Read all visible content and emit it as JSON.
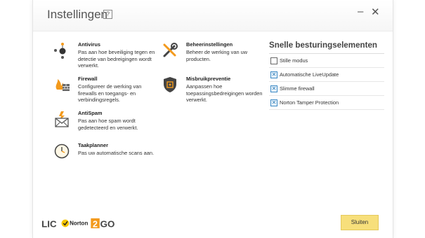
{
  "window": {
    "title": "Instellingen",
    "help_glyph": "?",
    "minimize_glyph": "–",
    "close_glyph": "✕"
  },
  "settings": [
    {
      "icon": "antivirus-icon",
      "name": "Antivirus",
      "desc": "Pas aan hoe beveiliging tegen en detectie van bedreigingen wordt verwerkt."
    },
    {
      "icon": "firewall-icon",
      "name": "Firewall",
      "desc": "Configureer de werking van firewalls en toegangs- en verbindingsregels."
    },
    {
      "icon": "antispam-icon",
      "name": "AntiSpam",
      "desc": "Pas aan hoe spam wordt gedetecteerd en verwerkt."
    },
    {
      "icon": "scheduler-icon",
      "name": "Taakplanner",
      "desc": "Pas uw automatische scans aan."
    },
    {
      "icon": "wrench-tools-icon",
      "name": "Beheerinstellingen",
      "desc": "Beheer de werking van uw producten."
    },
    {
      "icon": "shield-icon",
      "name": "Misbruikpreventie",
      "desc": "Aanpassen hoe toepassingsbedreigingen worden verwerkt."
    }
  ],
  "quick_controls": {
    "title": "Snelle besturingselementen",
    "items": [
      {
        "label": "Stille modus",
        "checked": false
      },
      {
        "label": "Automatische LiveUpdate",
        "checked": true
      },
      {
        "label": "Slimme firewall",
        "checked": true
      },
      {
        "label": "Norton Tamper Protection",
        "checked": true
      }
    ]
  },
  "footer": {
    "close_label": "Sluiten",
    "logo_text": "LIC2GO",
    "brand_text": "Norton"
  },
  "colors": {
    "accent_yellow": "#f7df7b",
    "checkbox_blue": "#3a88c4",
    "firewall_orange": "#f39a1d"
  }
}
